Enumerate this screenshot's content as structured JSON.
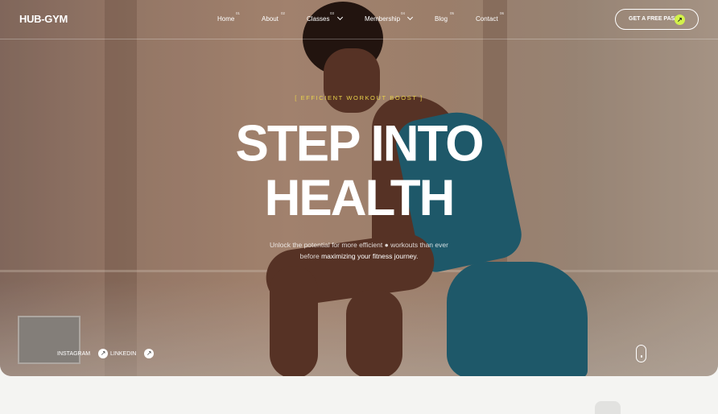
{
  "brand": {
    "logo": "HUB-GYM"
  },
  "nav": {
    "items": [
      {
        "label": "Home",
        "index": "01"
      },
      {
        "label": "About",
        "index": "02"
      },
      {
        "label": "Classes",
        "index": "03"
      },
      {
        "label": "Membership",
        "index": "04"
      },
      {
        "label": "Blog",
        "index": "05"
      },
      {
        "label": "Contact",
        "index": "06"
      }
    ],
    "cta_label": "GET A FREE PASS",
    "cta_icon": "↗"
  },
  "hero": {
    "eyebrow": "[ EFFICIENT WORKOUT BOOST ]",
    "headline_line1": "STEP INTO",
    "headline_line2": "HEALTH",
    "sub_part1": "Unlock the potential for more efficient",
    "sub_part2": "workouts than ever",
    "sub_part3": "before",
    "sub_highlight": "maximizing your fitness journey."
  },
  "social": {
    "instagram": "INSTAGRAM",
    "linkedin": "LINKEDIN",
    "arrow": "↗"
  },
  "colors": {
    "accent": "#d3f24a",
    "eyebrow": "#e8d14a",
    "shorts": "#1b5f74"
  }
}
